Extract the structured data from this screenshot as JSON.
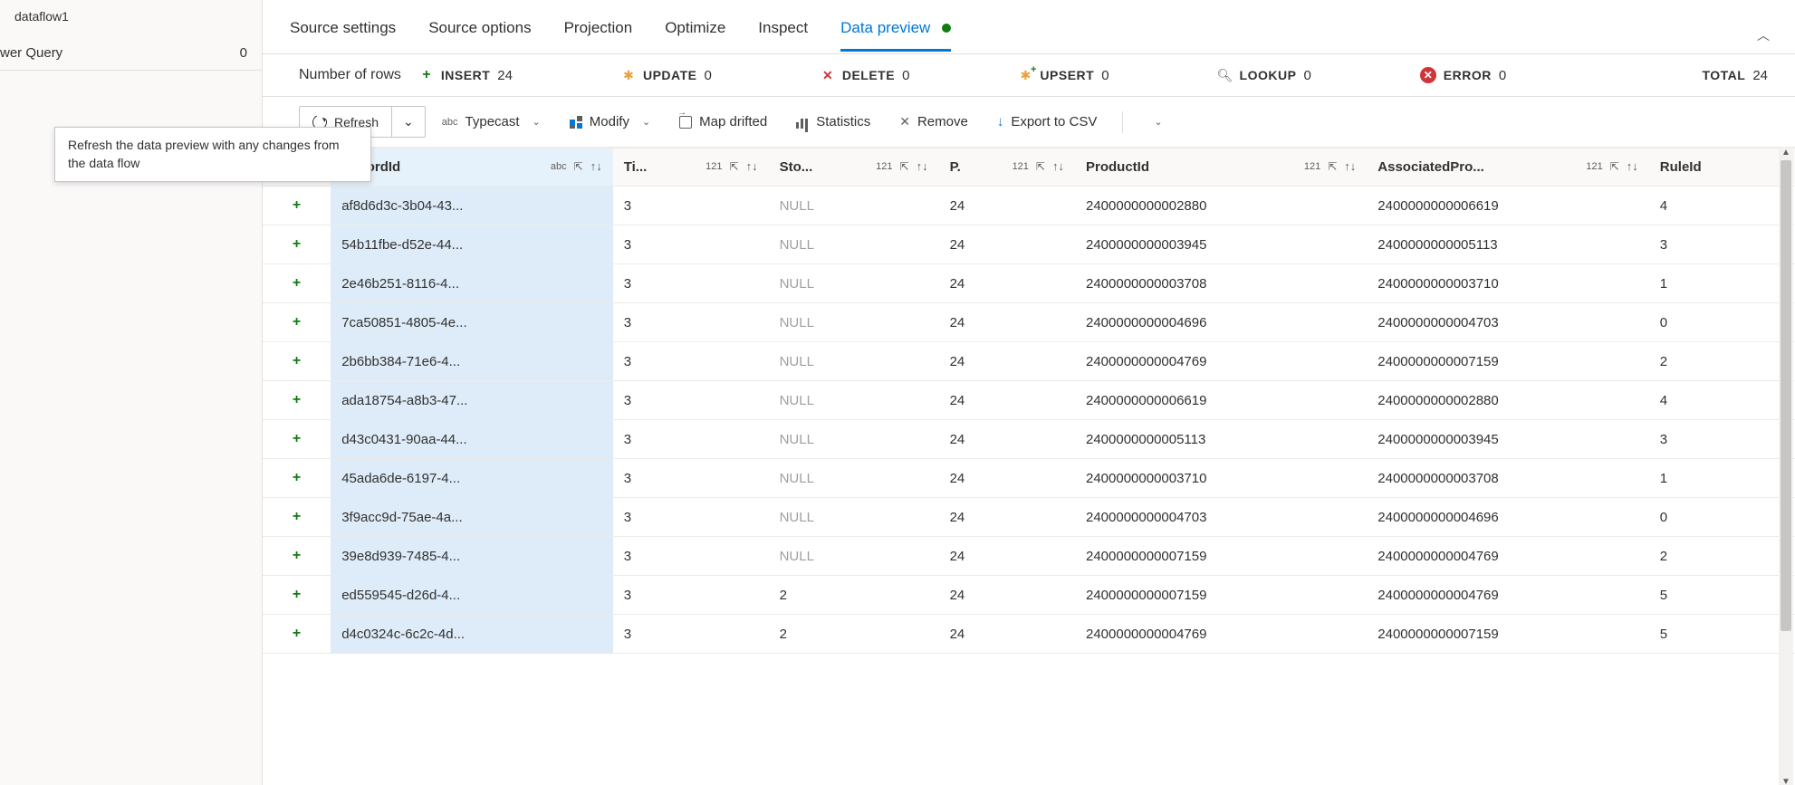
{
  "sidebar": {
    "title": "dataflow1",
    "query_label": "wer Query",
    "query_count": "0"
  },
  "tooltip": "Refresh the data preview with any changes from the data flow",
  "tabs": [
    {
      "label": "Source settings"
    },
    {
      "label": "Source options"
    },
    {
      "label": "Projection"
    },
    {
      "label": "Optimize"
    },
    {
      "label": "Inspect"
    },
    {
      "label": "Data preview",
      "active": true
    }
  ],
  "stats": {
    "lead": "Number of rows",
    "insert": {
      "label": "INSERT",
      "value": "24"
    },
    "update": {
      "label": "UPDATE",
      "value": "0"
    },
    "delete": {
      "label": "DELETE",
      "value": "0"
    },
    "upsert": {
      "label": "UPSERT",
      "value": "0"
    },
    "lookup": {
      "label": "LOOKUP",
      "value": "0"
    },
    "error": {
      "label": "ERROR",
      "value": "0"
    },
    "total": {
      "label": "TOTAL",
      "value": "24"
    }
  },
  "toolbar": {
    "refresh": "Refresh",
    "typecast": "Typecast",
    "modify": "Modify",
    "mapdrifted": "Map drifted",
    "statistics": "Statistics",
    "remove": "Remove",
    "export": "Export to CSV"
  },
  "columns": {
    "record": {
      "label": "RecordId",
      "type": "abc"
    },
    "ti": {
      "label": "Ti...",
      "type": "121"
    },
    "sto": {
      "label": "Sto...",
      "type": "121"
    },
    "p": {
      "label": "P.",
      "type": "121"
    },
    "product": {
      "label": "ProductId",
      "type": "121"
    },
    "assoc": {
      "label": "AssociatedPro...",
      "type": "121"
    },
    "rule": {
      "label": "RuleId"
    }
  },
  "rows": [
    {
      "record": "af8d6d3c-3b04-43...",
      "ti": "3",
      "sto": "NULL",
      "p": "24",
      "product": "2400000000002880",
      "assoc": "2400000000006619",
      "rule": "4"
    },
    {
      "record": "54b11fbe-d52e-44...",
      "ti": "3",
      "sto": "NULL",
      "p": "24",
      "product": "2400000000003945",
      "assoc": "2400000000005113",
      "rule": "3"
    },
    {
      "record": "2e46b251-8116-4...",
      "ti": "3",
      "sto": "NULL",
      "p": "24",
      "product": "2400000000003708",
      "assoc": "2400000000003710",
      "rule": "1"
    },
    {
      "record": "7ca50851-4805-4e...",
      "ti": "3",
      "sto": "NULL",
      "p": "24",
      "product": "2400000000004696",
      "assoc": "2400000000004703",
      "rule": "0"
    },
    {
      "record": "2b6bb384-71e6-4...",
      "ti": "3",
      "sto": "NULL",
      "p": "24",
      "product": "2400000000004769",
      "assoc": "2400000000007159",
      "rule": "2"
    },
    {
      "record": "ada18754-a8b3-47...",
      "ti": "3",
      "sto": "NULL",
      "p": "24",
      "product": "2400000000006619",
      "assoc": "2400000000002880",
      "rule": "4"
    },
    {
      "record": "d43c0431-90aa-44...",
      "ti": "3",
      "sto": "NULL",
      "p": "24",
      "product": "2400000000005113",
      "assoc": "2400000000003945",
      "rule": "3"
    },
    {
      "record": "45ada6de-6197-4...",
      "ti": "3",
      "sto": "NULL",
      "p": "24",
      "product": "2400000000003710",
      "assoc": "2400000000003708",
      "rule": "1"
    },
    {
      "record": "3f9acc9d-75ae-4a...",
      "ti": "3",
      "sto": "NULL",
      "p": "24",
      "product": "2400000000004703",
      "assoc": "2400000000004696",
      "rule": "0"
    },
    {
      "record": "39e8d939-7485-4...",
      "ti": "3",
      "sto": "NULL",
      "p": "24",
      "product": "2400000000007159",
      "assoc": "2400000000004769",
      "rule": "2"
    },
    {
      "record": "ed559545-d26d-4...",
      "ti": "3",
      "sto": "2",
      "p": "24",
      "product": "2400000000007159",
      "assoc": "2400000000004769",
      "rule": "5"
    },
    {
      "record": "d4c0324c-6c2c-4d...",
      "ti": "3",
      "sto": "2",
      "p": "24",
      "product": "2400000000004769",
      "assoc": "2400000000007159",
      "rule": "5"
    }
  ]
}
